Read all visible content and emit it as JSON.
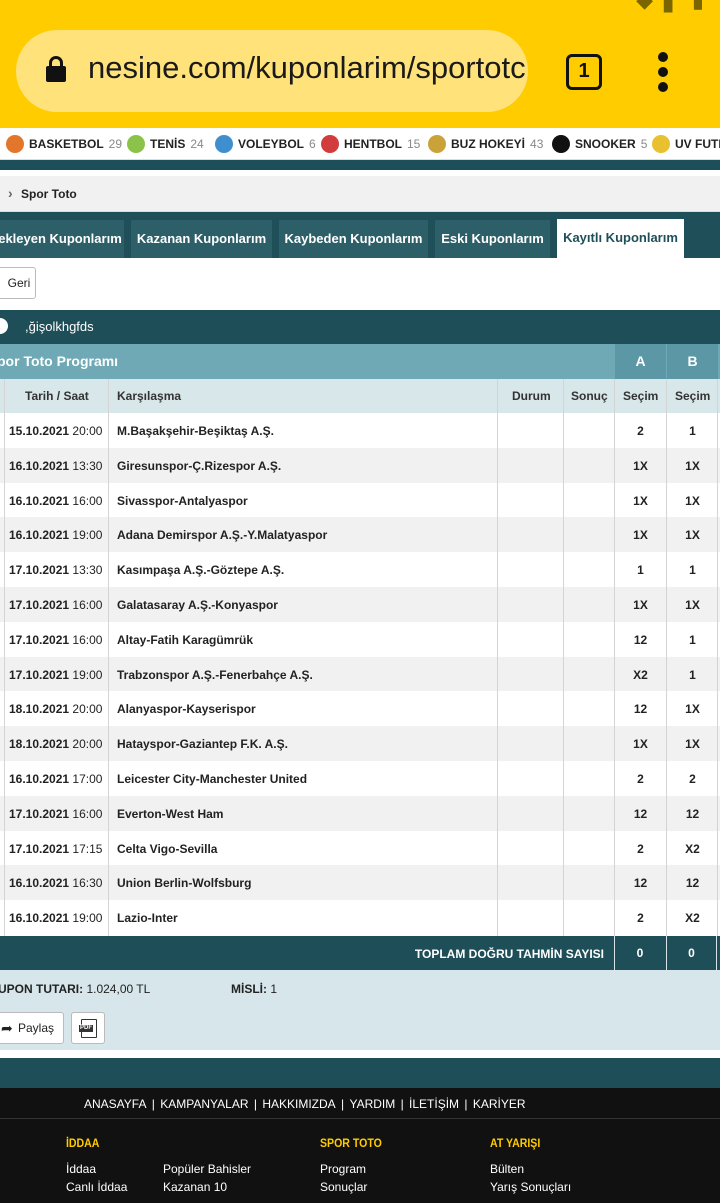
{
  "browser": {
    "url": "nesine.com/kuponlarim/sportotc",
    "tab_count": "1"
  },
  "sports": [
    {
      "name": "BASKETBOL",
      "count": "29",
      "color": "#e2762b"
    },
    {
      "name": "TENİS",
      "count": "24",
      "color": "#8bc34a"
    },
    {
      "name": "VOLEYBOL",
      "count": "6",
      "color": "#3f8fd0"
    },
    {
      "name": "HENTBOL",
      "count": "15",
      "color": "#d23c3c"
    },
    {
      "name": "BUZ HOKEYİ",
      "count": "43",
      "color": "#c9a23a"
    },
    {
      "name": "SNOOKER",
      "count": "5",
      "color": "#111111"
    },
    {
      "name": "UV FUTB",
      "count": "",
      "color": "#e8c030"
    }
  ],
  "breadcrumb": {
    "label": "Spor Toto"
  },
  "tabs": [
    {
      "label": "ekleyen Kuponlarım",
      "active": false
    },
    {
      "label": "Kazanan Kuponlarım",
      "active": false
    },
    {
      "label": "Kaybeden Kuponlarım",
      "active": false
    },
    {
      "label": "Eski Kuponlarım",
      "active": false
    },
    {
      "label": "Kayıtlı Kuponlarım",
      "active": true
    }
  ],
  "back_button": "Geri",
  "coupon_name": ",ğişolkhgfds",
  "program": {
    "title": "por Toto Programı",
    "col_a": "A",
    "col_b": "B"
  },
  "columns": {
    "date": "Tarih / Saat",
    "match": "Karşılaşma",
    "status": "Durum",
    "result": "Sonuç",
    "sel_a": "Seçim",
    "sel_b": "Seçim"
  },
  "matches": [
    {
      "date": "15.10.2021",
      "time": "20:00",
      "match": "M.Başakşehir-Beşiktaş A.Ş.",
      "a": "2",
      "b": "1"
    },
    {
      "date": "16.10.2021",
      "time": "13:30",
      "match": "Giresunspor-Ç.Rizespor A.Ş.",
      "a": "1X",
      "b": "1X"
    },
    {
      "date": "16.10.2021",
      "time": "16:00",
      "match": "Sivasspor-Antalyaspor",
      "a": "1X",
      "b": "1X"
    },
    {
      "date": "16.10.2021",
      "time": "19:00",
      "match": "Adana Demirspor A.Ş.-Y.Malatyaspor",
      "a": "1X",
      "b": "1X"
    },
    {
      "date": "17.10.2021",
      "time": "13:30",
      "match": "Kasımpaşa A.Ş.-Göztepe A.Ş.",
      "a": "1",
      "b": "1"
    },
    {
      "date": "17.10.2021",
      "time": "16:00",
      "match": "Galatasaray A.Ş.-Konyaspor",
      "a": "1X",
      "b": "1X"
    },
    {
      "date": "17.10.2021",
      "time": "16:00",
      "match": "Altay-Fatih Karagümrük",
      "a": "12",
      "b": "1"
    },
    {
      "date": "17.10.2021",
      "time": "19:00",
      "match": "Trabzonspor A.Ş.-Fenerbahçe A.Ş.",
      "a": "X2",
      "b": "1"
    },
    {
      "date": "18.10.2021",
      "time": "20:00",
      "match": "Alanyaspor-Kayserispor",
      "a": "12",
      "b": "1X"
    },
    {
      "date": "18.10.2021",
      "time": "20:00",
      "match": "Hatayspor-Gaziantep F.K. A.Ş.",
      "a": "1X",
      "b": "1X"
    },
    {
      "date": "16.10.2021",
      "time": "17:00",
      "match": "Leicester City-Manchester United",
      "a": "2",
      "b": "2"
    },
    {
      "date": "17.10.2021",
      "time": "16:00",
      "match": "Everton-West Ham",
      "a": "12",
      "b": "12"
    },
    {
      "date": "17.10.2021",
      "time": "17:15",
      "match": "Celta Vigo-Sevilla",
      "a": "2",
      "b": "X2"
    },
    {
      "date": "16.10.2021",
      "time": "16:30",
      "match": "Union Berlin-Wolfsburg",
      "a": "12",
      "b": "12"
    },
    {
      "date": "16.10.2021",
      "time": "19:00",
      "match": "Lazio-Inter",
      "a": "2",
      "b": "X2"
    }
  ],
  "total": {
    "label": "TOPLAM DOĞRU TAHMİN SAYISI",
    "a": "0",
    "b": "0"
  },
  "summary": {
    "amount_label": "UPON TUTARI:",
    "amount_value": "1.024,00 TL",
    "misli_label": "MİSLİ:",
    "misli_value": "1"
  },
  "actions": {
    "share": "Paylaş"
  },
  "footer": {
    "nav": [
      "ANASAYFA",
      "KAMPANYALAR",
      "HAKKIMIZDA",
      "YARDIM",
      "İLETİŞİM",
      "KARİYER"
    ],
    "iddaa": {
      "title": "İDDAA",
      "links": [
        "İddaa",
        "Canlı İddaa",
        "Popüler Bahisler",
        "Kazanan 10"
      ]
    },
    "spor_toto": {
      "title": "SPOR TOTO",
      "links": [
        "Program",
        "Sonuçlar"
      ]
    },
    "at_yarisi": {
      "title": "AT YARIŞI",
      "links": [
        "Bülten",
        "Yarış Sonuçları"
      ]
    }
  },
  "colors": {
    "brand_yellow": "#ffcc00",
    "teal_dark": "#1e4e58",
    "teal_light": "#6fa9b6"
  }
}
